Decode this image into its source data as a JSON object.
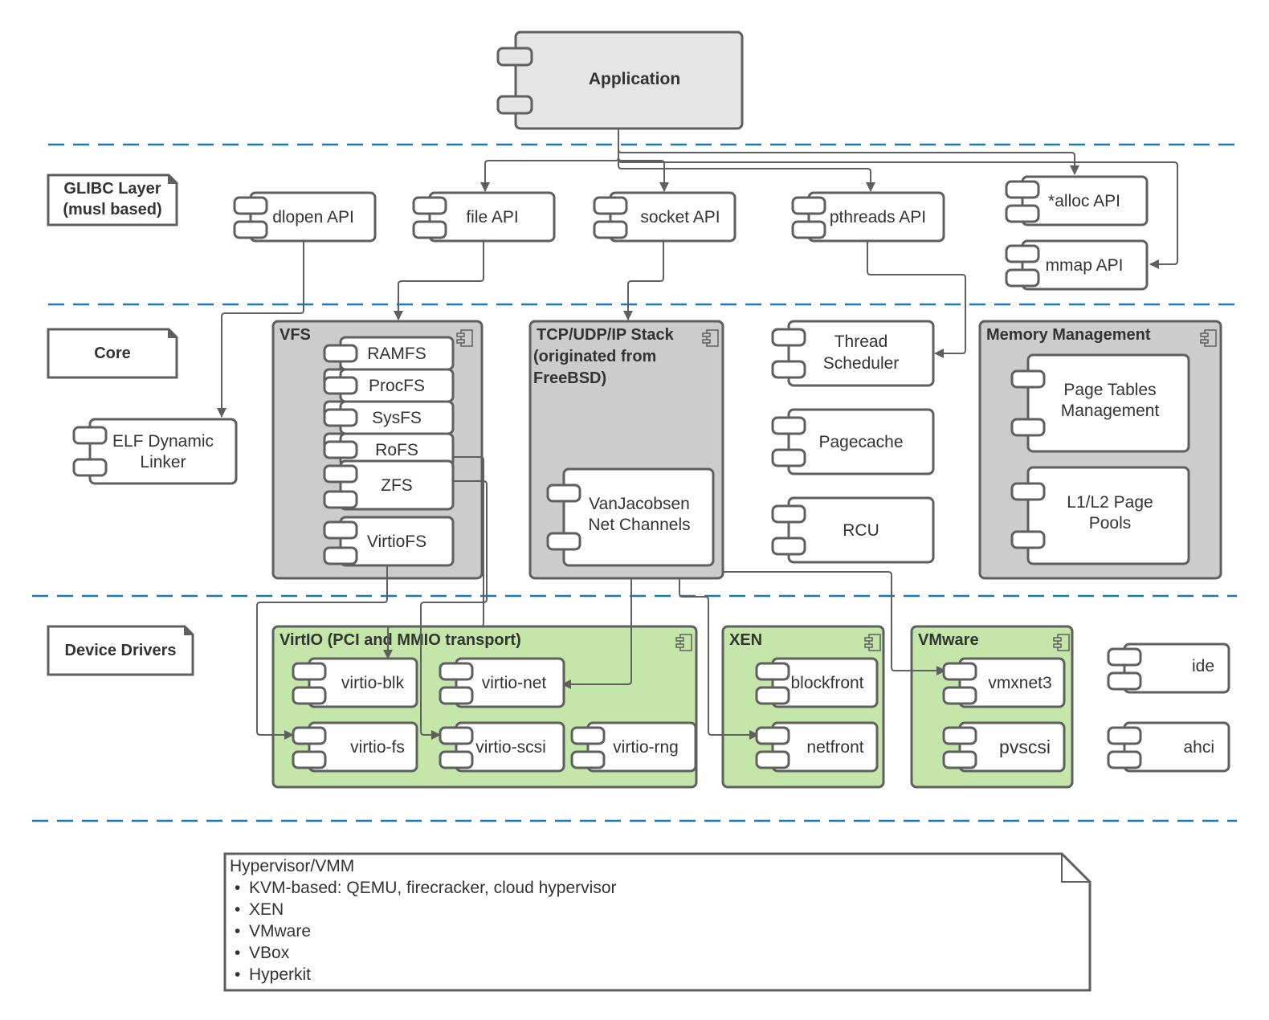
{
  "colors": {
    "stroke": "#5f5f5f",
    "separator": "#1a7ab8",
    "app_fill": "#e5e5e5",
    "container_gray": "#cccccc",
    "container_green": "#c5e6a9",
    "component_fill": "#ffffff",
    "text": "#333333"
  },
  "application": {
    "label": "Application"
  },
  "layers": {
    "glibc": {
      "line1": "GLIBC Layer",
      "line2": "(musl based)"
    },
    "core": {
      "label": "Core"
    },
    "drivers": {
      "label": "Device Drivers"
    }
  },
  "glibc_components": {
    "dlopen": "dlopen API",
    "file": "file API",
    "socket": "socket API",
    "pthreads": "pthreads API",
    "alloc": "*alloc API",
    "mmap": "mmap API"
  },
  "core": {
    "elf": {
      "line1": "ELF Dynamic",
      "line2": "Linker"
    },
    "vfs": {
      "title": "VFS",
      "items": [
        "RAMFS",
        "ProcFS",
        "SysFS",
        "RoFS",
        "ZFS",
        "VirtioFS"
      ]
    },
    "tcp": {
      "title_line1": "TCP/UDP/IP Stack",
      "title_line2": "(originated from",
      "title_line3": "FreeBSD)",
      "vanjacobsen": {
        "line1": "VanJacobsen",
        "line2": "Net Channels"
      }
    },
    "thread_scheduler": {
      "line1": "Thread",
      "line2": "Scheduler"
    },
    "pagecache": "Pagecache",
    "rcu": "RCU",
    "memory": {
      "title": "Memory Management",
      "page_tables": {
        "line1": "Page Tables",
        "line2": "Management"
      },
      "page_pools": {
        "line1": "L1/L2 Page",
        "line2": "Pools"
      }
    }
  },
  "drivers": {
    "virtio": {
      "title": "VirtIO (PCI and MMIO transport)",
      "items": [
        "virtio-blk",
        "virtio-net",
        "virtio-fs",
        "virtio-scsi",
        "virtio-rng"
      ]
    },
    "xen": {
      "title": "XEN",
      "items": [
        "blockfront",
        "netfront"
      ]
    },
    "vmware": {
      "title": "VMware",
      "items": [
        "vmxnet3",
        "pvscsi"
      ]
    },
    "standalone": [
      "ide",
      "ahci"
    ]
  },
  "hypervisor": {
    "title": "Hypervisor/VMM",
    "bullet": "•",
    "items": [
      "KVM-based: QEMU, firecracker, cloud hypervisor",
      "XEN",
      "VMware",
      "VBox",
      "Hyperkit"
    ]
  }
}
